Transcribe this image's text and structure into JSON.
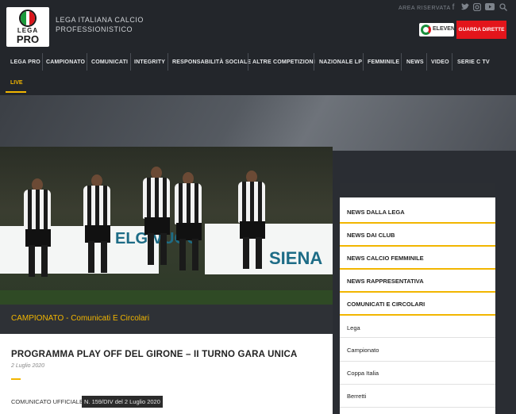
{
  "header": {
    "logo_lega": "LEGA",
    "logo_pro": "PRO",
    "org_name_line1": "LEGA ITALIANA CALCIO",
    "org_name_line2": "PROFESSIONISTICO",
    "area_riservata": "AREA RISERVATA",
    "social_icons": [
      "facebook-icon",
      "twitter-icon",
      "instagram-icon",
      "youtube-icon",
      "search-icon"
    ],
    "sport_logo_text": "ELEVEN",
    "guarda_dirette": "GUARDA DIRETTE"
  },
  "nav": {
    "items": [
      "LEGA PRO",
      "CAMPIONATO",
      "COMUNICATI",
      "INTEGRITY",
      "RESPONSABILITÀ SOCIALE",
      "ALTRE COMPETIZIONI",
      "NAZIONALE LP",
      "FEMMINILE",
      "NEWS",
      "VIDEO",
      "SERIE C TV"
    ],
    "live": "LIVE"
  },
  "hero": {
    "banner_left": "ELG VUOC",
    "banner_right": "SIENA",
    "caption": "CAMPIONATO - Comunicati E Circolari"
  },
  "article": {
    "title": "PROGRAMMA PLAY OFF DEL GIRONE – II TURNO GARA UNICA",
    "date": "2 Luglio 2020",
    "comunicato_label": "COMUNICATO UFFICIALE",
    "comunicato_ref": "N. 159/DIV del 2 Luglio 2020"
  },
  "sidebar": {
    "items": [
      {
        "label": "NEWS DALLA LEGA",
        "bold": true
      },
      {
        "label": "NEWS DAI CLUB",
        "bold": true
      },
      {
        "label": "NEWS CALCIO FEMMINILE",
        "bold": true
      },
      {
        "label": "NEWS RAPPRESENTATIVA",
        "bold": true
      },
      {
        "label": "COMUNICATI E CIRCOLARI",
        "bold": true
      },
      {
        "label": "Lega",
        "bold": false
      },
      {
        "label": "Campionato",
        "bold": false
      },
      {
        "label": "Coppa Italia",
        "bold": false
      },
      {
        "label": "Berretti",
        "bold": false
      }
    ]
  },
  "colors": {
    "accent": "#f2b600",
    "header_bg": "#23262b",
    "cta_red": "#e3151b"
  }
}
